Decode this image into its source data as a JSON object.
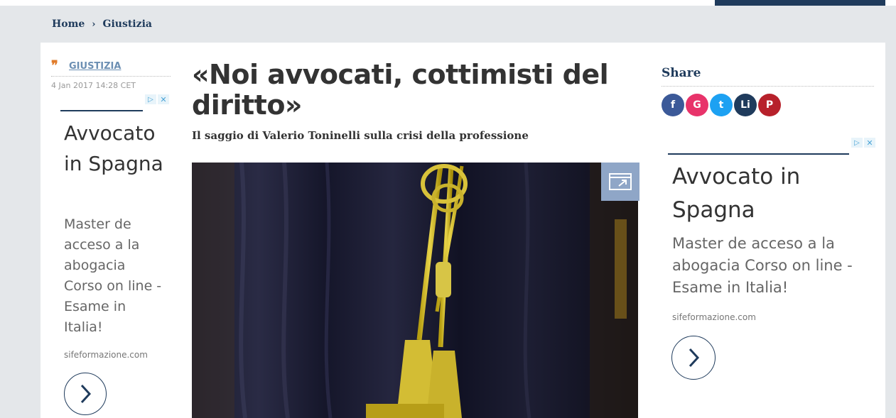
{
  "breadcrumb": {
    "home": "Home",
    "separator": "›",
    "section": "Giustizia"
  },
  "article": {
    "section_tag": "GIUSTIZIA",
    "quote_icon": "quote-icon",
    "date": "4 Jan 2017 14:28 CET",
    "headline": "«Noi avvocati, cottimisti del diritto»",
    "subtitle": "Il saggio di Valerio Toninelli sulla crisi della professione",
    "image_icon": "expand-gallery-icon"
  },
  "share": {
    "title": "Share",
    "buttons": [
      {
        "label": "f",
        "icon": "facebook-icon",
        "color": "#3b5998"
      },
      {
        "label": "G",
        "icon": "google-plus-icon",
        "color": "#e8336a"
      },
      {
        "label": "t",
        "icon": "twitter-icon",
        "color": "#1da1f2"
      },
      {
        "label": "Li",
        "icon": "linkedin-icon",
        "color": "#1f3b5c"
      },
      {
        "label": "P",
        "icon": "pinterest-icon",
        "color": "#b7212b"
      }
    ]
  },
  "ads": {
    "left": {
      "title": "Avvocato in Spagna",
      "body": "Master de acceso a la abogacia Corso on line - Esame in Italia!",
      "domain": "sifeformazione.com"
    },
    "right": {
      "title": "Avvocato in Spagna",
      "body": "Master de acceso a la abogacia Corso on line - Esame in Italia!",
      "domain": "sifeformazione.com"
    },
    "adchoices_icon": "adchoices-icon",
    "close_icon": "close-icon",
    "arrow_icon": "chevron-right-icon"
  },
  "colors": {
    "brand": "#1f3b5c",
    "accent": "#e07b2a",
    "background_gray": "#e4e7ea"
  }
}
